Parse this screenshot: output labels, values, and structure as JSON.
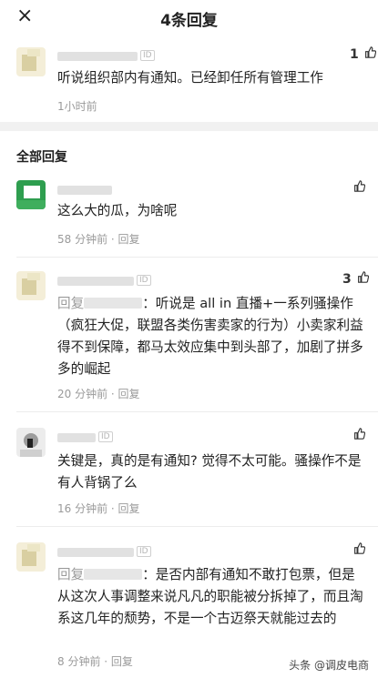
{
  "header": {
    "title": "4条回复",
    "close_icon": "×"
  },
  "main_comment": {
    "likes": "1",
    "text": "听说组织部内有通知。已经卸任所有管理工作",
    "time": "1小时前"
  },
  "section_title": "全部回复",
  "replies": [
    {
      "likes": "",
      "text": "这么大的瓜，为啥呢",
      "time": "58 分钟前 · 回复"
    },
    {
      "likes": "3",
      "reply_prefix": "回复",
      "text": "：听说是 all in 直播+一系列骚操作（疯狂大促，联盟各类伤害卖家的行为）小卖家利益得不到保障，都马太效应集中到头部了，加剧了拼多多的崛起",
      "time": "20 分钟前 · 回复"
    },
    {
      "likes": "",
      "text": "关键是，真的是有通知? 觉得不太可能。骚操作不是有人背锅了么",
      "time": "16 分钟前 · 回复"
    },
    {
      "likes": "",
      "reply_prefix": "回复",
      "text": "：是否内部有通知不敢打包票，但是从这次人事调整来说凡凡的职能被分拆掉了，而且淘系这几年的颓势，不是一个古迈祭天就能过去的",
      "time": "8 分钟前 · 回复"
    }
  ],
  "watermark": "头条 @调皮电商",
  "id_label": "ID",
  "colors": {
    "accent_green": "#2e9e4f",
    "meta_gray": "#9a9a9a",
    "separator": "#f1f1f1"
  },
  "icons": {
    "like": "thumbs-up-icon",
    "close": "close-icon"
  }
}
